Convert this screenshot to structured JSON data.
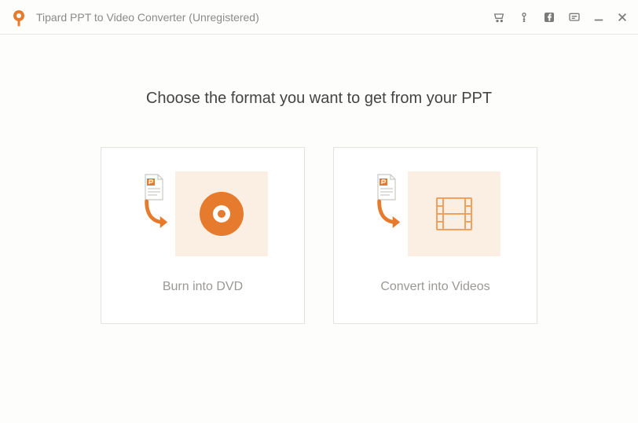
{
  "app": {
    "title": "Tipard PPT to Video Converter (Unregistered)"
  },
  "titlebar_icons": {
    "cart": "cart-icon",
    "key": "key-icon",
    "facebook": "facebook-icon",
    "message": "message-icon"
  },
  "main": {
    "heading": "Choose the format you want to get from your PPT",
    "options": [
      {
        "label": "Burn into DVD",
        "kind": "dvd"
      },
      {
        "label": "Convert into Videos",
        "kind": "video"
      }
    ]
  },
  "colors": {
    "accent": "#e77b2d",
    "accent_fill": "#f0a15e",
    "card_bg": "#fbeee3"
  }
}
